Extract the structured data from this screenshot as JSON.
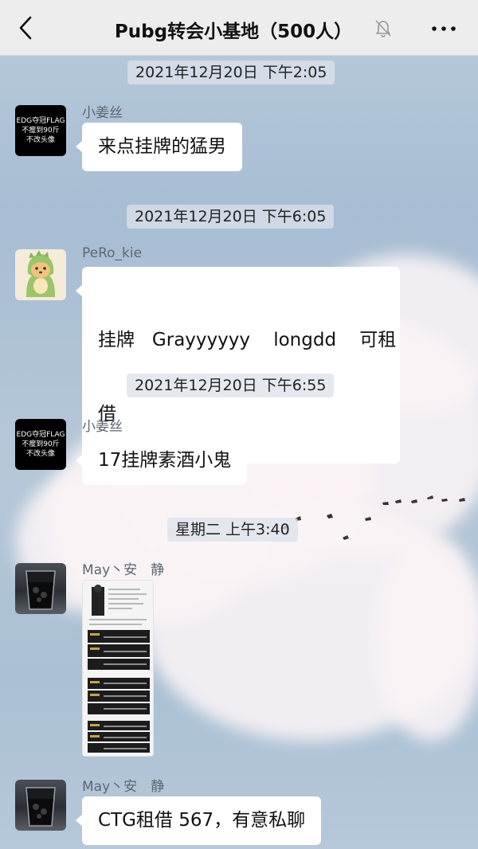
{
  "header": {
    "title": "Pubg转会小基地（500人）",
    "back_icon": "chevron-left-icon",
    "mute_icon": "bell-muted-icon",
    "more_icon": "more-dots-icon"
  },
  "messages": [
    {
      "time": "2021年12月20日 下午2:05",
      "sender": "小姜丝",
      "avatar_lines": [
        "EDG夺冠FLAG",
        "不瘦到90斤",
        "不改头像"
      ],
      "text": "来点挂牌的猛男"
    },
    {
      "time": "2021年12月20日 下午6:05",
      "sender": "PeRo_kie",
      "avatar": "dino-avatar",
      "text_lines": [
        "挂牌   Grayyyyyy    longdd    可租",
        "借"
      ]
    },
    {
      "time": "2021年12月20日 下午6:55",
      "sender": "小姜丝",
      "avatar_lines": [
        "EDG夺冠FLAG",
        "不瘦到90斤",
        "不改头像"
      ],
      "text": "17挂牌素酒小鬼"
    },
    {
      "time": "星期二 上午3:40",
      "sender": "May丶安　静",
      "avatar": "glass-avatar",
      "image": "roster-screenshot"
    },
    {
      "sender": "May丶安　静",
      "avatar": "glass-avatar",
      "text": "CTG租借 567，有意私聊"
    }
  ],
  "colors": {
    "topbar": "#ededed",
    "bubble": "#ffffff",
    "name": "#5d6670"
  }
}
